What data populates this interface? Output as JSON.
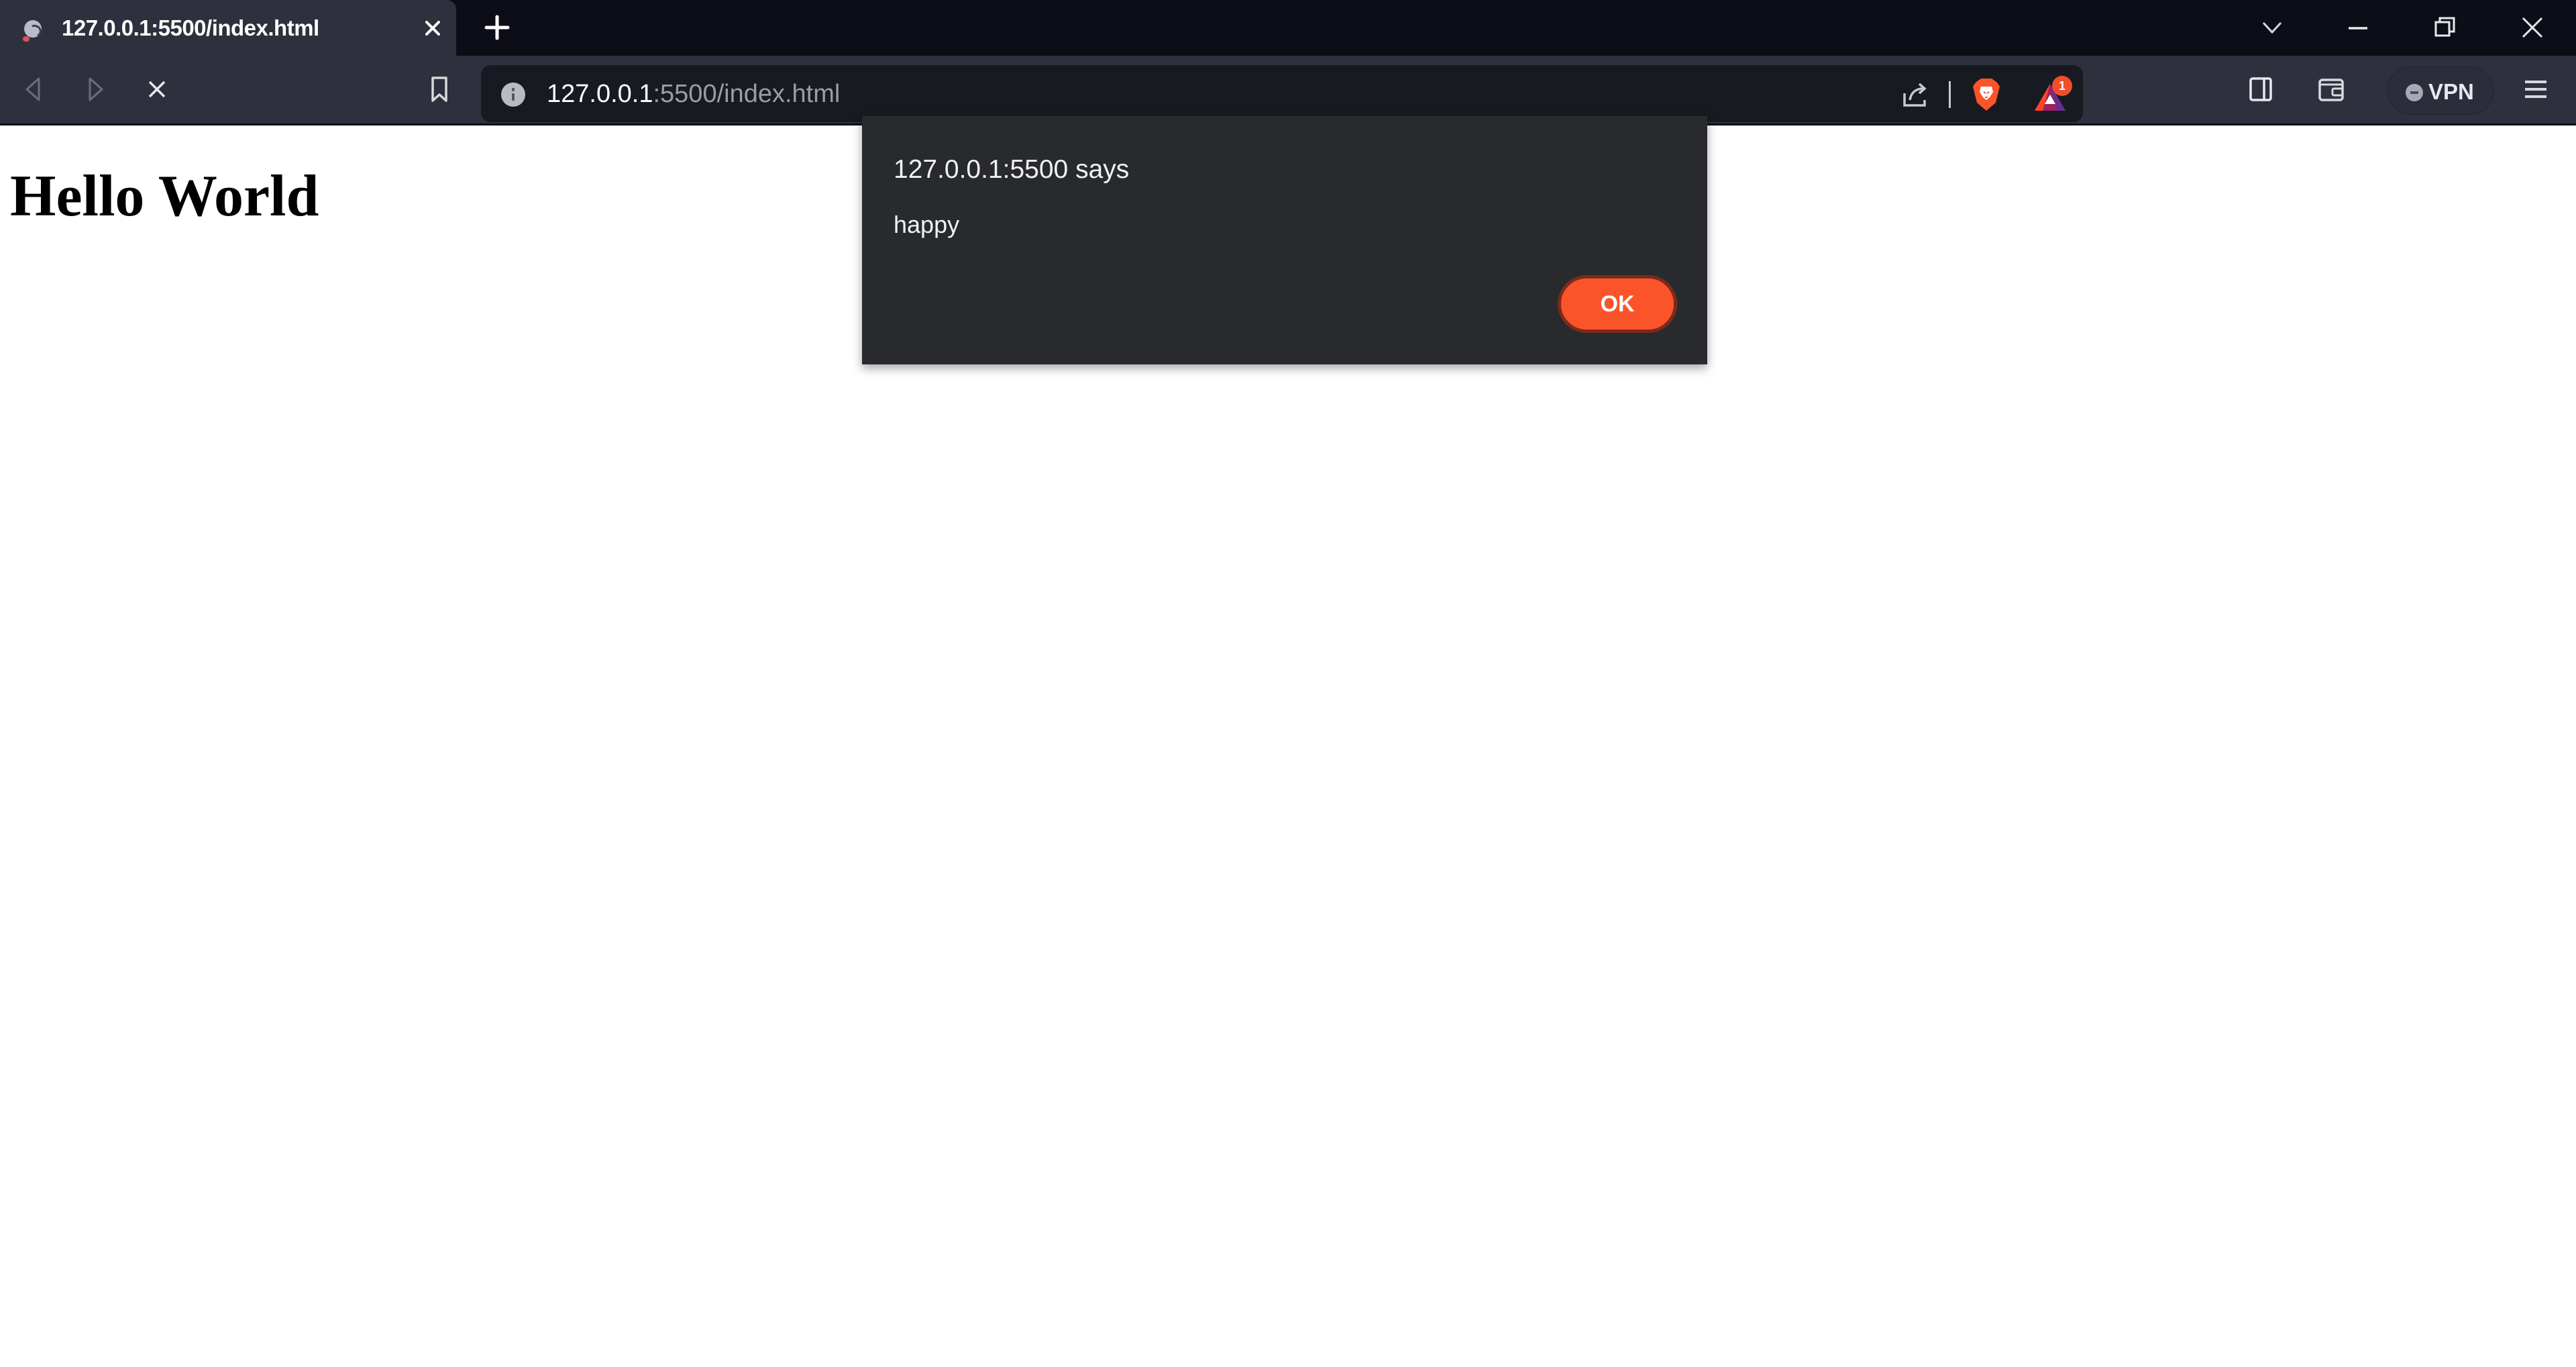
{
  "browser": {
    "name": "Brave",
    "tabs": [
      {
        "title": "127.0.0.1:5500/index.html",
        "active": true,
        "loading": true,
        "favicon": "globe-icon"
      }
    ],
    "new_tab_icon": "plus-icon",
    "window_controls": {
      "tab_search_icon": "chevron-down-icon",
      "minimize_icon": "minimize-icon",
      "restore_icon": "restore-icon",
      "close_icon": "close-icon"
    },
    "toolbar": {
      "back_icon": "back-arrow-icon",
      "back_enabled": false,
      "forward_icon": "forward-arrow-icon",
      "forward_enabled": false,
      "stop_icon": "stop-loading-icon",
      "bookmark_icon": "bookmark-icon",
      "address": {
        "site_info_icon": "info-icon",
        "host": "127.0.0.1",
        "rest": ":5500/index.html",
        "full_url": "127.0.0.1:5500/index.html"
      },
      "share_icon": "share-icon",
      "shields_icon": "brave-shields-icon",
      "rewards_icon": "brave-rewards-icon",
      "rewards_badge": "1",
      "sidebar_icon": "sidebar-icon",
      "wallet_icon": "wallet-icon",
      "vpn_label": "VPN",
      "vpn_status": "disconnected",
      "menu_icon": "hamburger-menu-icon"
    },
    "colors": {
      "tabstrip_bg": "#0c0d16",
      "toolbar_bg": "#2e313d",
      "omnibox_bg": "#181a21",
      "dialog_bg": "#292a2d",
      "accent": "#fb542b"
    }
  },
  "page": {
    "heading": "Hello World"
  },
  "alert": {
    "title": "127.0.0.1:5500 says",
    "message": "happy",
    "ok_label": "OK"
  }
}
